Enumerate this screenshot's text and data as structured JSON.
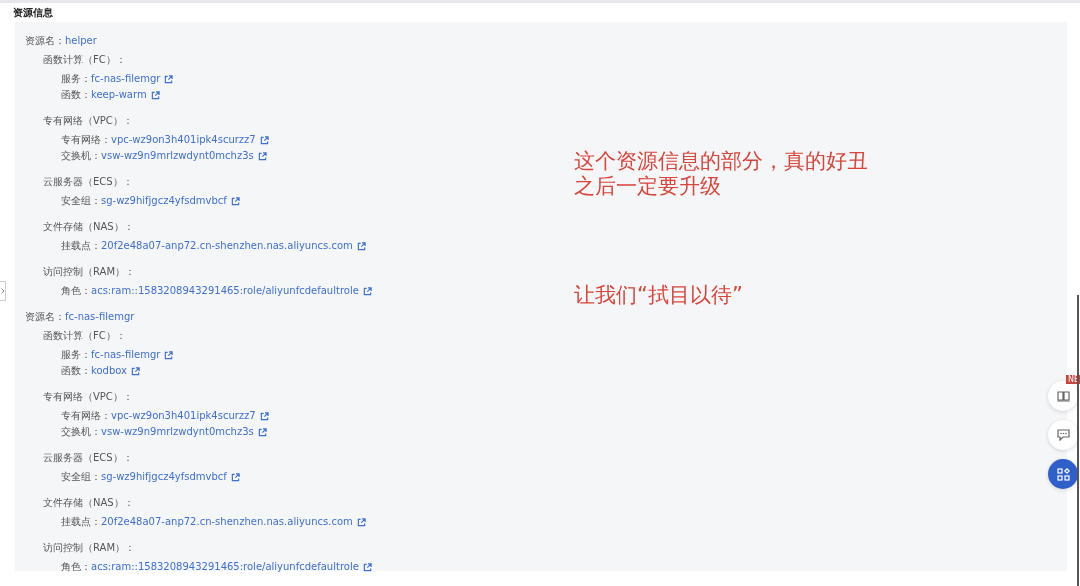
{
  "section_title": "资源信息",
  "resources": [
    {
      "label": "资源名：",
      "name": "helper",
      "groups": [
        {
          "title": "函数计算（FC）：",
          "items": [
            {
              "label": "服务：",
              "value": "fc-nas-filemgr"
            },
            {
              "label": "函数：",
              "value": "keep-warm"
            }
          ]
        },
        {
          "title": "专有网络（VPC）：",
          "items": [
            {
              "label": "专有网络：",
              "value": "vpc-wz9on3h401ipk4scurzz7"
            },
            {
              "label": "交换机：",
              "value": "vsw-wz9n9mrlzwdynt0mchz3s"
            }
          ]
        },
        {
          "title": "云服务器（ECS）：",
          "items": [
            {
              "label": "安全组：",
              "value": "sg-wz9hifjgcz4yfsdmvbcf"
            }
          ]
        },
        {
          "title": "文件存储（NAS）：",
          "items": [
            {
              "label": "挂载点：",
              "value": "20f2e48a07-anp72.cn-shenzhen.nas.aliyuncs.com"
            }
          ]
        },
        {
          "title": "访问控制（RAM）：",
          "items": [
            {
              "label": "角色：",
              "value": "acs:ram::1583208943291465:role/aliyunfcdefaultrole"
            }
          ]
        }
      ]
    },
    {
      "label": "资源名：",
      "name": "fc-nas-filemgr",
      "groups": [
        {
          "title": "函数计算（FC）：",
          "items": [
            {
              "label": "服务：",
              "value": "fc-nas-filemgr"
            },
            {
              "label": "函数：",
              "value": "kodbox"
            }
          ]
        },
        {
          "title": "专有网络（VPC）：",
          "items": [
            {
              "label": "专有网络：",
              "value": "vpc-wz9on3h401ipk4scurzz7"
            },
            {
              "label": "交换机：",
              "value": "vsw-wz9n9mrlzwdynt0mchz3s"
            }
          ]
        },
        {
          "title": "云服务器（ECS）：",
          "items": [
            {
              "label": "安全组：",
              "value": "sg-wz9hifjgcz4yfsdmvbcf"
            }
          ]
        },
        {
          "title": "文件存储（NAS）：",
          "items": [
            {
              "label": "挂载点：",
              "value": "20f2e48a07-anp72.cn-shenzhen.nas.aliyuncs.com"
            }
          ]
        },
        {
          "title": "访问控制（RAM）：",
          "items": [
            {
              "label": "角色：",
              "value": "acs:ram::1583208943291465:role/aliyunfcdefaultrole"
            }
          ]
        }
      ]
    }
  ],
  "annotations": [
    {
      "lines": [
        "这个资源信息的部分，真的好丑",
        "之后一定要升级"
      ]
    },
    {
      "lines": [
        "让我们“拭目以待”"
      ]
    }
  ],
  "floating_buttons": [
    {
      "kind": "guide",
      "badge": "NE"
    },
    {
      "kind": "feedback"
    },
    {
      "kind": "apps"
    }
  ]
}
